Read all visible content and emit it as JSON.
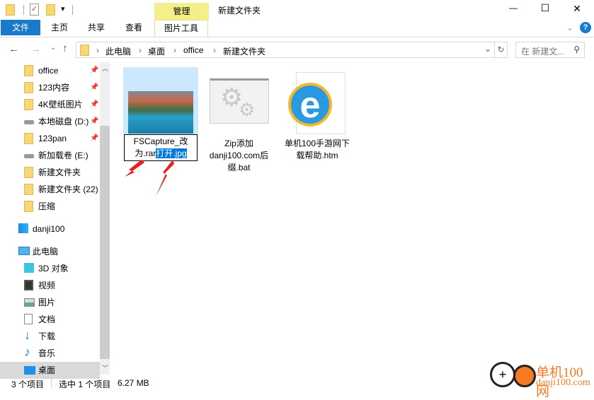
{
  "title_bar": {
    "title": "新建文件夹",
    "context_tab": "管理",
    "qat_dropdown": "▾"
  },
  "window_controls": {
    "minimize": "—",
    "maximize": "☐",
    "close": "✕"
  },
  "ribbon": {
    "tabs": [
      {
        "label": "文件"
      },
      {
        "label": "主页"
      },
      {
        "label": "共享"
      },
      {
        "label": "查看"
      },
      {
        "label": "图片工具"
      }
    ],
    "collapse": "⌄",
    "help": "?"
  },
  "address": {
    "crumbs": [
      "此电脑",
      "桌面",
      "office",
      "新建文件夹"
    ],
    "separator": "›",
    "search_placeholder": "在 新建文...",
    "refresh": "↻",
    "dropdown": "⌄"
  },
  "nav": {
    "quick_access": [
      {
        "label": "office",
        "icon": "folder-icon",
        "pinned": true
      },
      {
        "label": "123内容",
        "icon": "folder-icon",
        "pinned": true
      },
      {
        "label": "4K壁纸图片",
        "icon": "folder-icon",
        "pinned": true
      },
      {
        "label": "本地磁盘 (D:)",
        "icon": "drive-icon",
        "pinned": true
      },
      {
        "label": "123pan",
        "icon": "folder-icon",
        "pinned": true
      },
      {
        "label": "新加载卷 (E:)",
        "icon": "drive-icon",
        "pinned": false
      },
      {
        "label": "新建文件夹",
        "icon": "folder-icon",
        "pinned": false
      },
      {
        "label": "新建文件夹 (22)",
        "icon": "folder-icon",
        "pinned": false
      },
      {
        "label": "压缩",
        "icon": "folder-icon",
        "pinned": false
      }
    ],
    "cloud": "danji100",
    "this_pc": "此电脑",
    "pc_items": [
      {
        "label": "3D 对象",
        "icon": "cube-icon"
      },
      {
        "label": "视频",
        "icon": "video-icon"
      },
      {
        "label": "图片",
        "icon": "picture-icon"
      },
      {
        "label": "文档",
        "icon": "document-icon"
      },
      {
        "label": "下载",
        "icon": "download-icon"
      },
      {
        "label": "音乐",
        "icon": "music-icon"
      },
      {
        "label": "桌面",
        "icon": "desktop-icon",
        "selected": true
      }
    ]
  },
  "files": [
    {
      "name_line1": "FSCapture_改",
      "name_pre": "为.rar",
      "name_sel": "打开.jpg",
      "selected": true,
      "renaming": true
    },
    {
      "name": "Zip添加danji100.com后缀.bat"
    },
    {
      "name": "单机100手游网下载帮助.htm"
    }
  ],
  "status": {
    "count": "3 个项目",
    "selected": "选中 1 个项目",
    "size": "6.27 MB"
  },
  "watermark": {
    "text": "单机100网",
    "sub": "danji100.com"
  },
  "colors": {
    "accent": "#1979ca",
    "selection": "#cce8ff",
    "context_tab": "#f3f08c",
    "rename_highlight": "#0078d7"
  }
}
